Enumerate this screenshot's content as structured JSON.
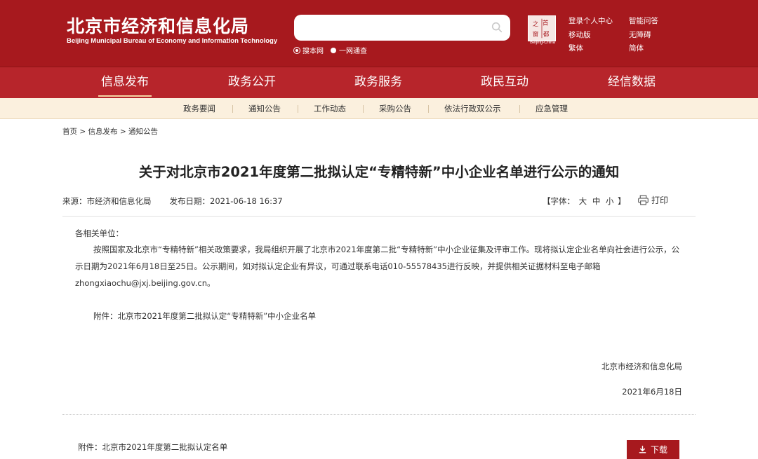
{
  "header": {
    "title": "北京市经济和信息化局",
    "subtitle": "Beijing Municipal Bureau of Economy and Information Technology",
    "search_placeholder": "",
    "radio_options": [
      "搜本网",
      "一网通查"
    ],
    "seal_chars": [
      "之",
      "首",
      "都",
      "窗"
    ],
    "seal_caption": "Beijing-China",
    "links_col1": [
      "登录个人中心",
      "移动版",
      "繁体"
    ],
    "links_col2": [
      "智能问答",
      "无障碍",
      "简体"
    ]
  },
  "nav": {
    "items": [
      "信息发布",
      "政务公开",
      "政务服务",
      "政民互动",
      "经信数据"
    ],
    "active": "信息发布"
  },
  "subnav": {
    "items": [
      "政务要闻",
      "通知公告",
      "工作动态",
      "采购公告",
      "依法行政双公示",
      "应急管理"
    ]
  },
  "breadcrumb": {
    "home": "首页",
    "sep": ">",
    "level1": "信息发布",
    "level2": "通知公告"
  },
  "article": {
    "title": "关于对北京市2021年度第二批拟认定“专精特新”中小企业名单进行公示的通知",
    "source_label": "来源：",
    "source": "市经济和信息化局",
    "date_label": "发布日期：",
    "date": "2021-06-18 16:37",
    "font_label_open": "【字体：",
    "font_options": [
      "大",
      "中",
      "小"
    ],
    "font_label_close": "】",
    "print_label": "打印",
    "salutation": "各相关单位：",
    "paragraph": "按照国家及北京市“专精特新”相关政策要求，我局组织开展了北京市2021年度第二批“专精特新”中小企业征集及评审工作。现将拟认定企业名单向社会进行公示，公示日期为2021年6月18日至25日。公示期间，如对拟认定企业有异议，可通过联系电话010-55578435进行反映，并提供相关证据材料至电子邮箱zhongxiaochu@jxj.beijing.gov.cn。",
    "attachment_line": "附件：北京市2021年度第二批拟认定“专精特新”中小企业名单",
    "sign_org": "北京市经济和信息化局",
    "sign_date": "2021年6月18日"
  },
  "attachment": {
    "file_label": "附件：北京市2021年度第二批拟认定名单",
    "download_label": "下载"
  },
  "colors": {
    "brand_red": "#a7191e",
    "nav_red": "#b7252b",
    "subnav_bg": "#fbf0de"
  }
}
